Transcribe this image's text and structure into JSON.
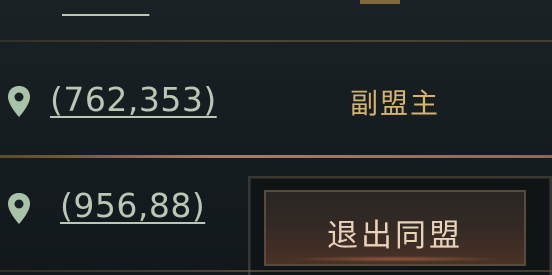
{
  "rows": [
    {
      "coord": "(--,--)"
    },
    {
      "coord": "(762,353)",
      "rank": "副盟主"
    },
    {
      "coord": "(956,88)"
    }
  ],
  "actions": {
    "leave_label": "退出同盟"
  },
  "colors": {
    "coord_text": "#b9c7b4",
    "rank_text": "#d7b46e",
    "divider_gold": "#a5854e",
    "button_text": "#e8d2b8"
  },
  "icons": {
    "location": "location-pin-icon"
  }
}
